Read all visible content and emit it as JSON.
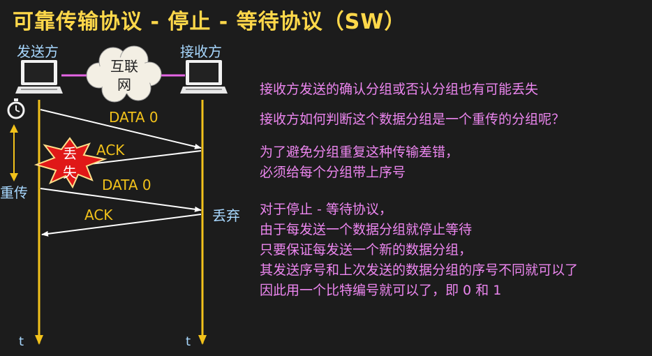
{
  "title": "可靠传输协议 - 停止 - 等待协议（SW）",
  "sender_label": "发送方",
  "receiver_label": "接收方",
  "cloud_label": [
    "互联",
    "网"
  ],
  "loss_label": [
    "丢",
    "失"
  ],
  "retransmit_label": "重传",
  "discard_label": "丢弃",
  "time_label_left": "t",
  "time_label_right": "t",
  "messages": [
    "DATA 0",
    "ACK",
    "DATA 0",
    "ACK"
  ],
  "notes": {
    "p1": [
      "接收方发送的确认分组或否认分组也有可能丢失"
    ],
    "p2": [
      "接收方如何判断这个数据分组是一个重传的分组呢？"
    ],
    "p3": [
      "为了避免分组重复这种传输差错，",
      "必须给每个分组带上序号"
    ],
    "p4": [
      "对于停止 - 等待协议，",
      "由于每发送一个数据分组就停止等待",
      "只要保证每发送一个新的数据分组，",
      "其发送序号和上次发送的数据分组的序号不同就可以了",
      "因此用一个比特编号就可以了，即 0 和 1"
    ]
  },
  "colors": {
    "title": "#ffd84a",
    "timeline": "#f2c21b",
    "arrow": "#ffffff",
    "message_label": "#f2c21b",
    "link": "#e565e5",
    "note": "#ec86ef",
    "role": "#a8d8ff",
    "loss_burst": "#e01818"
  },
  "icons": [
    "laptop-icon",
    "cloud-icon",
    "stopwatch-icon",
    "explosion-icon"
  ]
}
